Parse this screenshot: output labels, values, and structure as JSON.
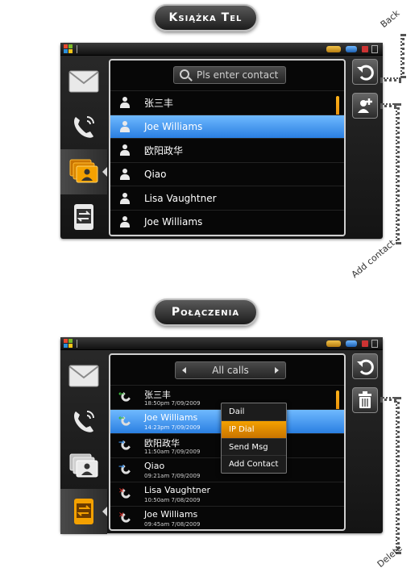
{
  "sections": [
    {
      "title": "Książka Tel",
      "search_placeholder": "Pls enter contact",
      "contacts": [
        {
          "name": "张三丰",
          "selected": false
        },
        {
          "name": "Joe Williams",
          "selected": true
        },
        {
          "name": "欧阳政华",
          "selected": false
        },
        {
          "name": "Qiao",
          "selected": false
        },
        {
          "name": "Lisa Vaughtner",
          "selected": false
        },
        {
          "name": "Joe Williams",
          "selected": false
        }
      ],
      "annotations": {
        "back": "Back",
        "add_contact": "Add contact"
      }
    },
    {
      "title": "Połączenia",
      "filter_label": "All calls",
      "calls": [
        {
          "name": "张三丰",
          "time": "18:50pm  7/09/2009",
          "type": "incoming",
          "selected": false
        },
        {
          "name": "Joe Williams",
          "time": "14:23pm  7/09/2009",
          "type": "incoming",
          "selected": true
        },
        {
          "name": "欧阳政华",
          "time": "11:50am  7/09/2009",
          "type": "outgoing",
          "selected": false
        },
        {
          "name": "Qiao",
          "time": "09:21am  7/09/2009",
          "type": "outgoing",
          "selected": false
        },
        {
          "name": "Lisa Vaughtner",
          "time": "10:50am  7/08/2009",
          "type": "missed",
          "selected": false
        },
        {
          "name": "Joe Williams",
          "time": "09:45am  7/08/2009",
          "type": "missed",
          "selected": false
        }
      ],
      "context_menu": {
        "items": [
          {
            "label": "Dail",
            "highlighted": false
          },
          {
            "label": "IP Dial",
            "highlighted": true
          },
          {
            "label": "Send Msg",
            "highlighted": false
          },
          {
            "label": "Add Contact",
            "highlighted": false
          }
        ]
      },
      "annotations": {
        "delete": "Delete"
      }
    }
  ],
  "colors": {
    "selection_blue": "#3f92f0",
    "accent_orange": "#f4a100",
    "incoming_green": "#3dbb3d",
    "outgoing_blue": "#3a8fe6",
    "missed_red": "#e0302a"
  },
  "icons": {
    "sidebar": [
      "envelope-icon",
      "phone-icon",
      "contacts-icon",
      "call-log-icon"
    ],
    "right_top": [
      "back-icon",
      "add-contact-icon",
      "delete-icon"
    ]
  }
}
